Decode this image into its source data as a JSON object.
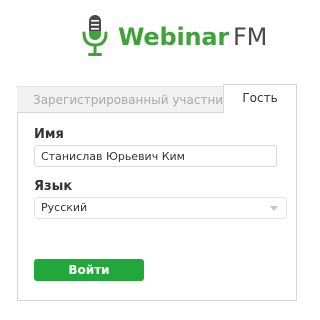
{
  "logo": {
    "brand_name": "Webinar",
    "brand_suffix": "FM",
    "icon": "microphone-icon",
    "colors": {
      "green": "#3fa33a",
      "gray": "#4a4a4a"
    }
  },
  "tabs": [
    {
      "label": "Зарегистрированный участник",
      "active": false
    },
    {
      "label": "Гость",
      "active": true
    }
  ],
  "form": {
    "name_label": "Имя",
    "name_value": "Станислав Юрьевич Ким",
    "language_label": "Язык",
    "language_value": "Русский",
    "submit_label": "Войти"
  },
  "colors": {
    "accent": "#22a83a",
    "border": "#d7d7d7"
  }
}
